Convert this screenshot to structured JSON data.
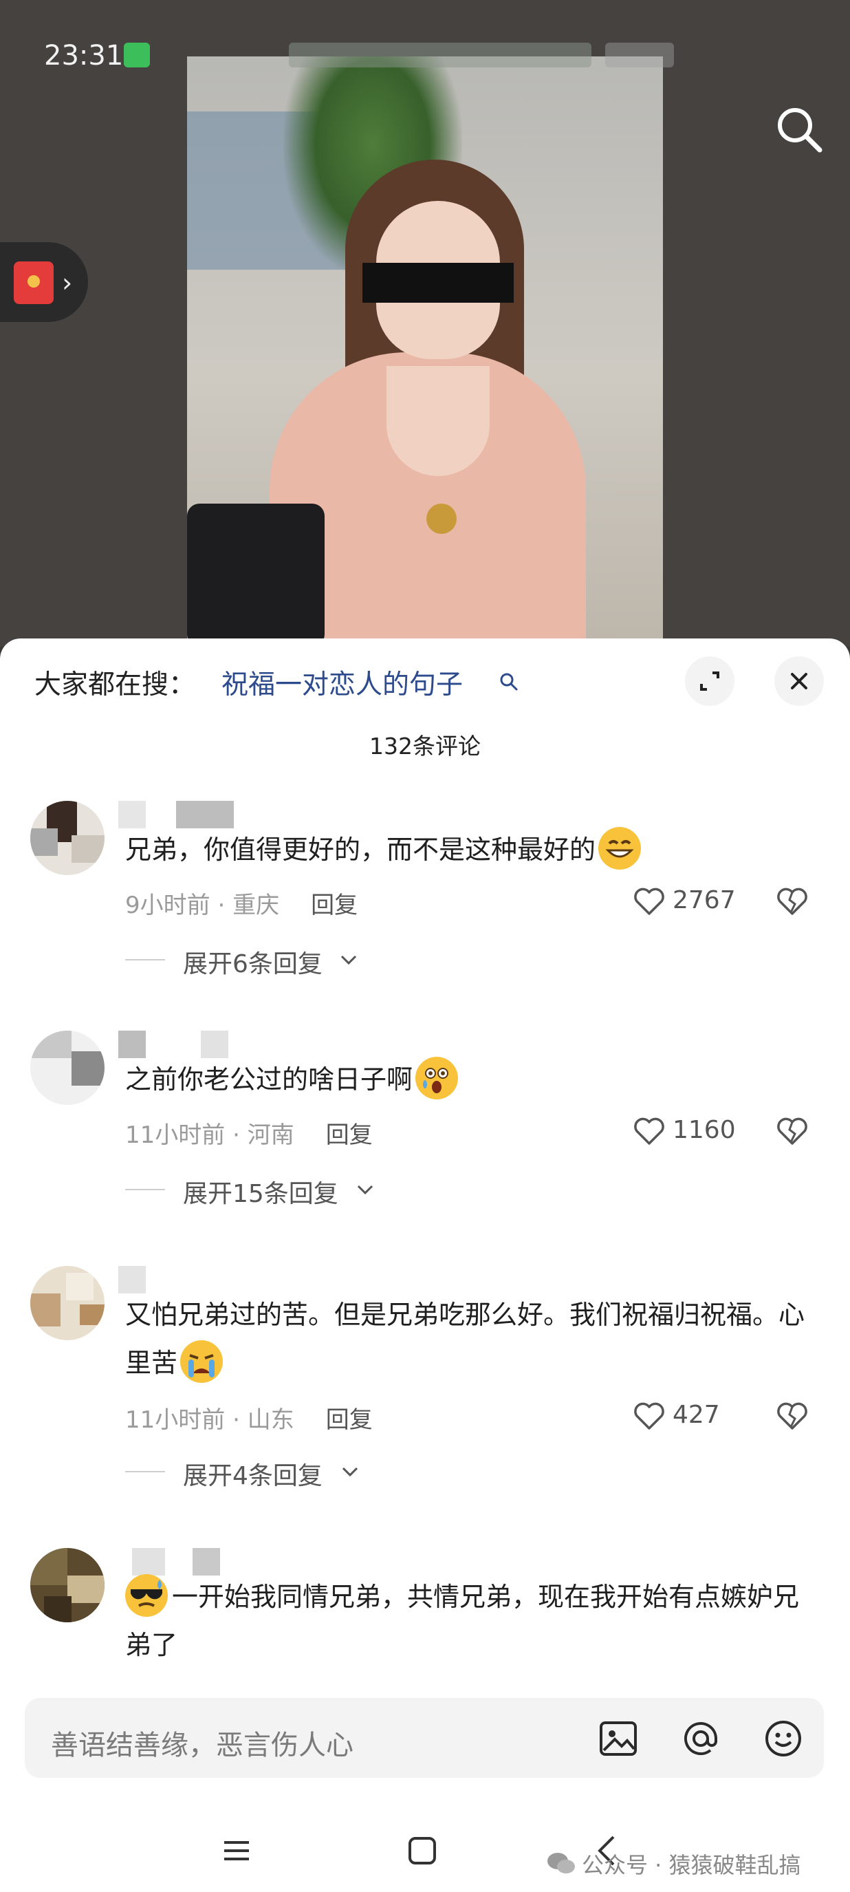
{
  "status_bar": {
    "time": "23:31"
  },
  "comment_panel": {
    "search_prefix": "大家都在搜：",
    "search_term": "祝福一对恋人的句子",
    "count_label": "132条评论"
  },
  "comments": [
    {
      "text": "兄弟，你值得更好的，而不是这种最好的",
      "emoji": "grinning-face",
      "time": "9小时前",
      "region": "重庆",
      "reply_label": "回复",
      "likes": "2767",
      "expand_label": "展开6条回复"
    },
    {
      "text": "之前你老公过的啥日子啊",
      "emoji": "astonished-face",
      "time": "11小时前",
      "region": "河南",
      "reply_label": "回复",
      "likes": "1160",
      "expand_label": "展开15条回复"
    },
    {
      "text": "又怕兄弟过的苦。但是兄弟吃那么好。我们祝福归祝福。心里苦",
      "emoji": "crying-face",
      "time": "11小时前",
      "region": "山东",
      "reply_label": "回复",
      "likes": "427",
      "expand_label": "展开4条回复"
    },
    {
      "text": "一开始我同情兄弟，共情兄弟，现在我开始有点嫉妒兄弟了",
      "emoji": "cool-sweat-face"
    }
  ],
  "input": {
    "placeholder": "善语结善缘，恶言伤人心"
  },
  "watermark": {
    "text": "公众号 · 猿猿破鞋乱搞"
  },
  "colors": {
    "accent_link": "#2c4a8c",
    "secondary_text": "#9a9a9a",
    "sheet_bg": "#ffffff"
  }
}
